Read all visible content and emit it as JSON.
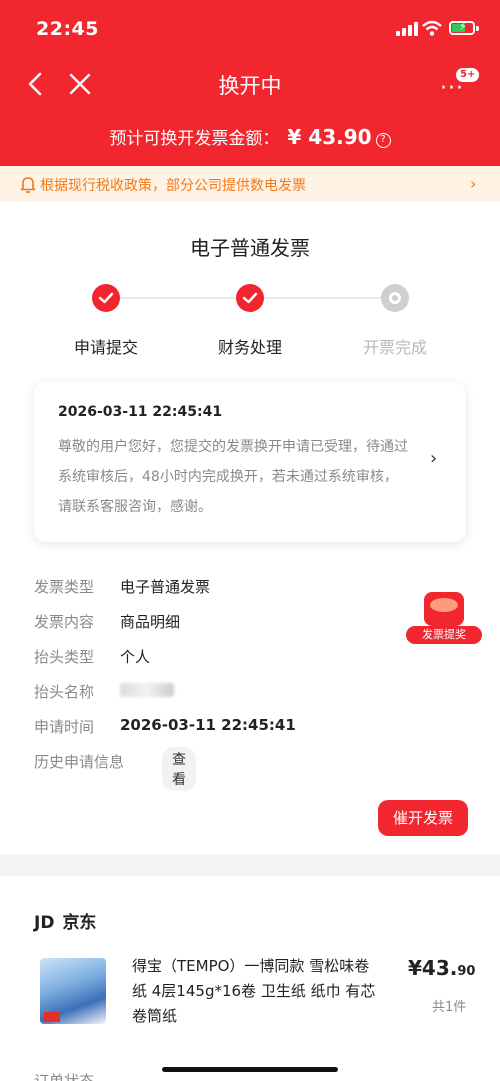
{
  "status_bar": {
    "time": "22:45"
  },
  "nav": {
    "title": "换开中",
    "more_badge": "5+"
  },
  "amount": {
    "label": "预计可换开发票金额：",
    "value": "¥ 43.90"
  },
  "notice": {
    "text": "根据现行税收政策，部分公司提供数电发票"
  },
  "invoice": {
    "title": "电子普通发票",
    "steps": [
      {
        "label": "申请提交",
        "state": "done"
      },
      {
        "label": "财务处理",
        "state": "done"
      },
      {
        "label": "开票完成",
        "state": "pending"
      }
    ]
  },
  "progress": {
    "timestamp": "2026-03-11 22:45:41",
    "message": "尊敬的用户您好，您提交的发票换开申请已受理，待通过系统审核后，48小时内完成换开，若未通过系统审核，请联系客服咨询，感谢。"
  },
  "details": [
    {
      "key": "发票类型",
      "value": "电子普通发票"
    },
    {
      "key": "发票内容",
      "value": "商品明细"
    },
    {
      "key": "抬头类型",
      "value": "个人"
    },
    {
      "key": "抬头名称",
      "value": ""
    },
    {
      "key": "申请时间",
      "value": "2026-03-11 22:45:41"
    },
    {
      "key": "历史申请信息",
      "value": ""
    }
  ],
  "view_button": "查看",
  "gift_tag": "发票提奖",
  "urge_button": "催开发票",
  "order": {
    "shop_logo": "JD",
    "shop_name": "京东",
    "product_name": "得宝（TEMPO）一博同款 雪松味卷纸 4层145g*16卷 卫生纸 纸巾 有芯卷筒纸",
    "price_main": "¥43.",
    "price_decimal": "90",
    "quantity": "共1件",
    "status_label": "订单状态"
  },
  "colors": {
    "brand_red": "#f2262f",
    "notice_bg": "#fff3e5",
    "notice_text": "#f07a1a"
  }
}
